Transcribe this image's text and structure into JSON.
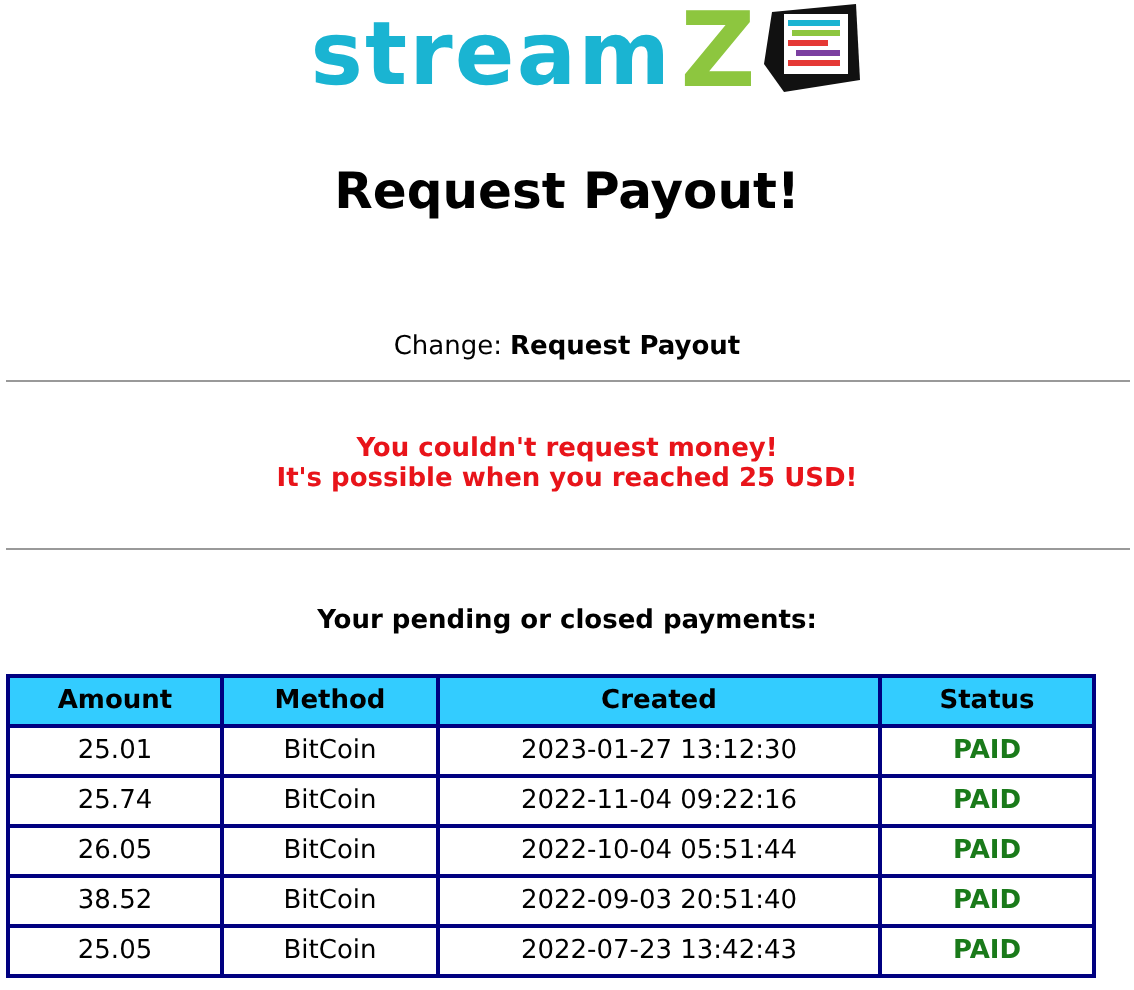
{
  "logo": {
    "text": "stream",
    "accent": "Z"
  },
  "title": "Request Payout!",
  "change": {
    "label": "Change:",
    "link": "Request Payout"
  },
  "error": [
    "You couldn't request money!",
    "It's possible when you reached 25 USD!"
  ],
  "payments_heading": "Your pending or closed payments:",
  "table": {
    "columns": [
      "Amount",
      "Method",
      "Created",
      "Status"
    ],
    "rows": [
      {
        "amount": "25.01",
        "method": "BitCoin",
        "created": "2023-01-27 13:12:30",
        "status": "PAID"
      },
      {
        "amount": "25.74",
        "method": "BitCoin",
        "created": "2022-11-04 09:22:16",
        "status": "PAID"
      },
      {
        "amount": "26.05",
        "method": "BitCoin",
        "created": "2022-10-04 05:51:44",
        "status": "PAID"
      },
      {
        "amount": "38.52",
        "method": "BitCoin",
        "created": "2022-09-03 20:51:40",
        "status": "PAID"
      },
      {
        "amount": "25.05",
        "method": "BitCoin",
        "created": "2022-07-23 13:42:43",
        "status": "PAID"
      }
    ]
  }
}
